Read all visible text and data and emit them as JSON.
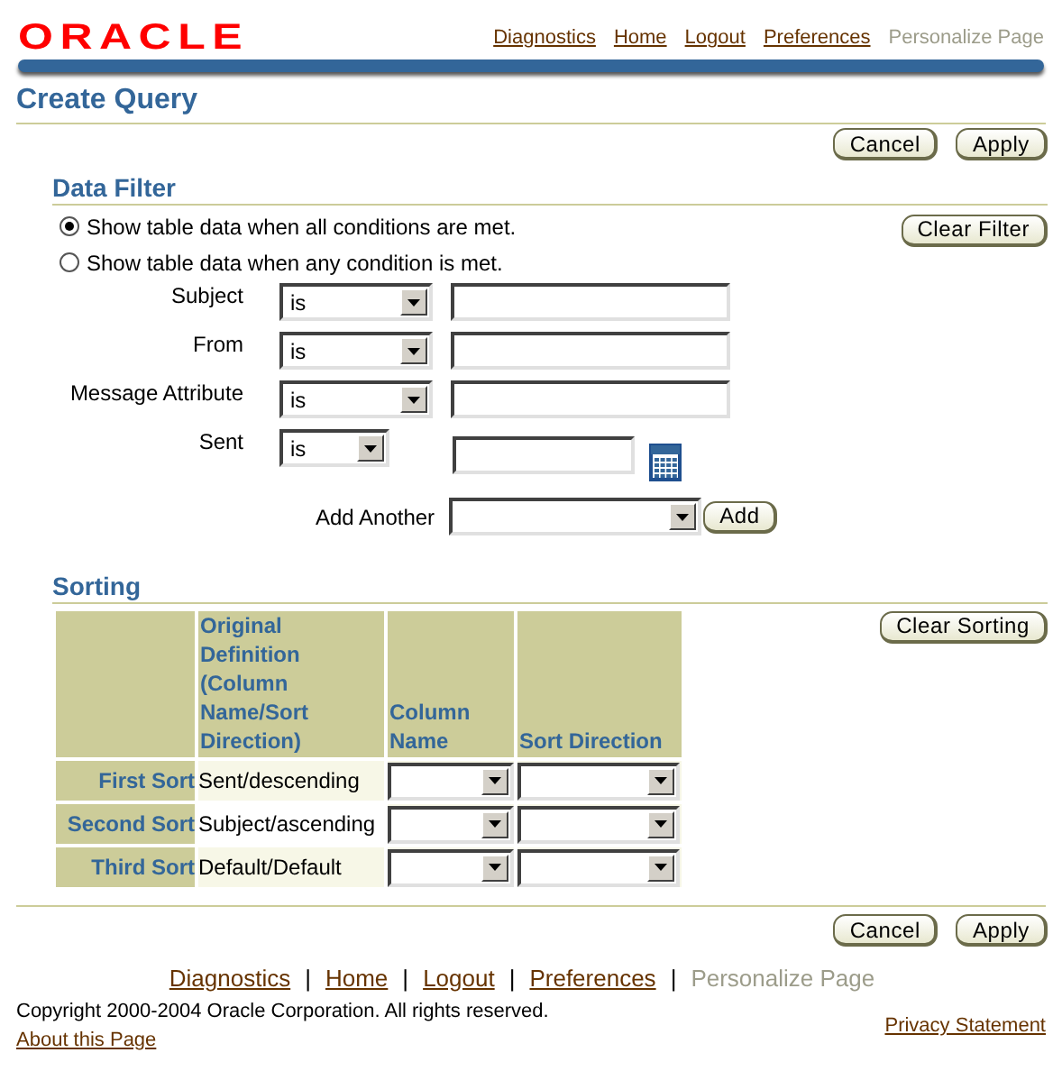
{
  "logo": "ORACLE",
  "global_links": [
    {
      "label": "Diagnostics",
      "disabled": false
    },
    {
      "label": "Home",
      "disabled": false
    },
    {
      "label": "Logout",
      "disabled": false
    },
    {
      "label": "Preferences",
      "disabled": false
    },
    {
      "label": "Personalize Page",
      "disabled": true
    }
  ],
  "title": "Create Query",
  "top_buttons": [
    "Cancel",
    "Apply"
  ],
  "data_filter": {
    "heading": "Data Filter",
    "clear_button": "Clear Filter",
    "match_options": [
      {
        "label": "Show table data when all conditions are met.",
        "selected": true
      },
      {
        "label": "Show table data when any condition is met.",
        "selected": false
      }
    ],
    "conditions": [
      {
        "kind": "text",
        "label": "Subject",
        "operator": "is"
      },
      {
        "kind": "text",
        "label": "From",
        "operator": "is"
      },
      {
        "kind": "text",
        "label": "Message Attribute",
        "operator": "is"
      },
      {
        "kind": "date",
        "label": "Sent",
        "operator": "is"
      }
    ],
    "add_another": {
      "label": "Add Another",
      "button": "Add"
    }
  },
  "sorting": {
    "heading": "Sorting",
    "clear_button": "Clear Sorting",
    "columns": [
      "Original Definition (Column Name/Sort Direction)",
      "Column Name",
      "Sort Direction"
    ],
    "rows": [
      {
        "label": "First Sort",
        "original": "Sent/descending"
      },
      {
        "label": "Second Sort",
        "original": "Subject/ascending"
      },
      {
        "label": "Third Sort",
        "original": "Default/Default"
      }
    ]
  },
  "bottom_buttons": [
    "Cancel",
    "Apply"
  ],
  "footer_links": [
    {
      "label": "Diagnostics",
      "disabled": false
    },
    {
      "label": "Home",
      "disabled": false
    },
    {
      "label": "Logout",
      "disabled": false
    },
    {
      "label": "Preferences",
      "disabled": false
    },
    {
      "label": "Personalize Page",
      "disabled": true
    }
  ],
  "separator": "|",
  "copyright": "Copyright 2000-2004 Oracle Corporation. All rights reserved.",
  "about_link": "About this Page",
  "privacy_link": "Privacy Statement"
}
